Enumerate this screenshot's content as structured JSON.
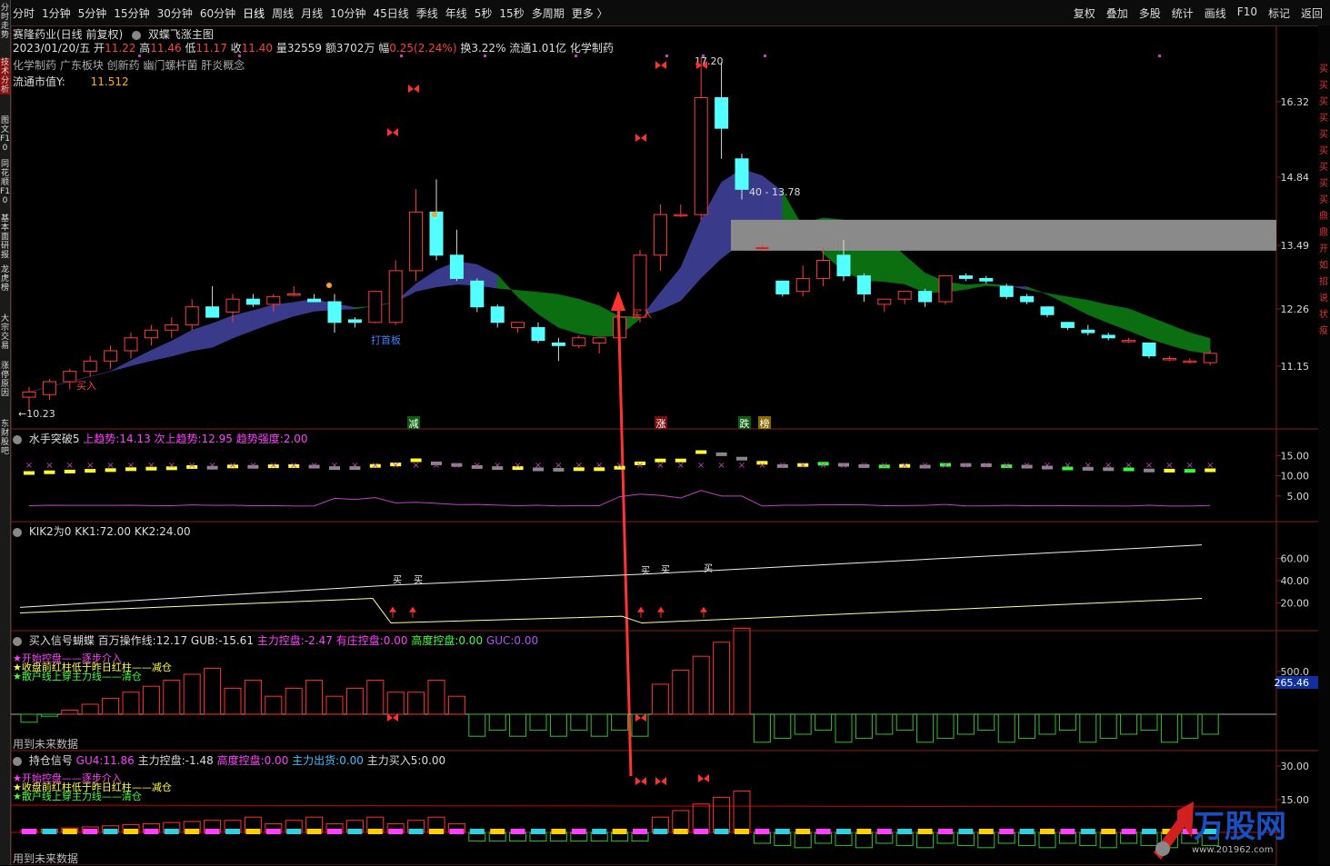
{
  "sidebar": {
    "items": [
      "分时走势",
      "技术分析",
      "图文F10",
      "同花顺F10",
      "基本面研报",
      "龙虎榜",
      "大宗交易",
      "涨停原因",
      "东财股吧"
    ]
  },
  "toolbar": {
    "periods": [
      "分时",
      "1分钟",
      "5分钟",
      "15分钟",
      "30分钟",
      "60分钟",
      "日线",
      "周线",
      "月线",
      "10分钟",
      "45日线",
      "季线",
      "年线",
      "5秒",
      "15秒",
      "多周期",
      "更多 〉"
    ],
    "tools": [
      "复权",
      "叠加",
      "多股",
      "统计",
      "画线",
      "F10",
      "标记",
      "返回"
    ]
  },
  "stock": {
    "title": "赛隆药业(日线 前复权)",
    "main_indicator": "双蝶飞涨主图",
    "date": "2023/01/20/五",
    "open_label": "开",
    "open": "11.22",
    "high_label": "高",
    "high": "11.46",
    "low_label": "低",
    "low": "11.17",
    "close_label": "收",
    "close": "11.40",
    "vol_label": "量",
    "vol": "32559",
    "amount_label": "额",
    "amount": "3702万",
    "change_label": "幅",
    "change": "0.25(2.24%)",
    "turnover_label": "换",
    "turnover": "3.22%",
    "float_label": "流通",
    "float": "1.01亿",
    "sector_main": "化学制药",
    "sectors": "化学制药 广东板块 创新药 幽门螺杆菌 肝炎概念",
    "mv_label": "流通市值Y:",
    "mv_value": "11.512"
  },
  "price_axis": [
    "16.32",
    "14.84",
    "13.49",
    "12.26",
    "11.15"
  ],
  "chart_labels": {
    "high_mark": "17.20",
    "low_mark": "10.23",
    "range_mark": "40 - 13.78",
    "buy_entry": "买入",
    "buy_entry2": "买入",
    "limit_label": "打首板",
    "marker_reduce": "减",
    "marker_rise": "涨",
    "marker_fall": "跌",
    "marker_bang": "榜"
  },
  "panel1": {
    "name": "水手突破5",
    "v1_label": "上趋势:",
    "v1": "14.13",
    "v2_label": "次上趋势:",
    "v2": "12.95",
    "v3_label": "趋势强度:",
    "v3": "2.00",
    "axis": [
      "15.00",
      "10.00",
      "5.00"
    ]
  },
  "panel2": {
    "name": "KIK2为0",
    "v1_label": "KK1:",
    "v1": "72.00",
    "v2_label": "KK2:",
    "v2": "24.00",
    "axis": [
      "60.00",
      "40.00",
      "20.00"
    ],
    "mark_buy": "买"
  },
  "panel3": {
    "name": "买入信号蝴蝶",
    "v1_label": "百万操作线:",
    "v1": "12.17",
    "v2_label": "GUB:",
    "v2": "-15.61",
    "v3_label": "主力控盘:",
    "v3": "-2.47",
    "v4_label": "有庄控盘:",
    "v4": "0.00",
    "v5_label": "高度控盘:",
    "v5": "0.00",
    "v6_label": "GUC:",
    "v6": "0.00",
    "legend1": "★开始控盘——逐步介入",
    "legend2": "★收盘前红柱低于昨日红柱——减仓",
    "legend3": "★散户线上穿主力线——清仓",
    "future_note": "用到未来数据",
    "axis": [
      "500.0"
    ],
    "axis_highlight": "265.46"
  },
  "panel4": {
    "name": "持仓信号",
    "v1_label": "GU4:",
    "v1": "11.86",
    "v2_label": "主力控盘:",
    "v2": "-1.48",
    "v3_label": "高度控盘:",
    "v3": "0.00",
    "v4_label": "主力出货:",
    "v4": "0.00",
    "v5_label": "主力买入5:",
    "v5": "0.00",
    "legend1": "★开始控盘——逐步介入",
    "legend2": "★收盘前红柱低于昨日红柱——减仓",
    "legend3": "★散户线上穿主力线——清仓",
    "future_note": "用到未来数据",
    "axis": [
      "30.00",
      "15.00"
    ]
  },
  "watermark": {
    "brand": "万股网",
    "url": "www.201962.com"
  },
  "right_strip": "买买买买买买买买买鼎鼎开如招说状疫",
  "colors": {
    "up": "#ff3b3b",
    "down": "#54ffff",
    "bg": "#000000",
    "axis": "#8b1a1a",
    "ribbon_up": "#3a3a8a",
    "ribbon_down": "#0b6e10",
    "gray_box": "#8a8a8a",
    "arrow": "#ff3333"
  },
  "candles": [
    {
      "o": 10.55,
      "h": 10.75,
      "l": 10.3,
      "c": 10.65
    },
    {
      "o": 10.6,
      "h": 10.9,
      "l": 10.5,
      "c": 10.85
    },
    {
      "o": 10.85,
      "h": 11.1,
      "l": 10.7,
      "c": 11.05
    },
    {
      "o": 11.05,
      "h": 11.35,
      "l": 10.95,
      "c": 11.25
    },
    {
      "o": 11.25,
      "h": 11.55,
      "l": 11.1,
      "c": 11.45
    },
    {
      "o": 11.45,
      "h": 11.8,
      "l": 11.3,
      "c": 11.7
    },
    {
      "o": 11.7,
      "h": 11.95,
      "l": 11.55,
      "c": 11.85
    },
    {
      "o": 11.85,
      "h": 12.1,
      "l": 11.7,
      "c": 11.95
    },
    {
      "o": 11.95,
      "h": 12.45,
      "l": 11.85,
      "c": 12.3
    },
    {
      "o": 12.3,
      "h": 12.7,
      "l": 12.1,
      "c": 12.1
    },
    {
      "o": 12.2,
      "h": 12.55,
      "l": 12.0,
      "c": 12.45
    },
    {
      "o": 12.45,
      "h": 12.55,
      "l": 12.3,
      "c": 12.35
    },
    {
      "o": 12.35,
      "h": 12.55,
      "l": 12.2,
      "c": 12.5
    },
    {
      "o": 12.55,
      "h": 12.7,
      "l": 12.5,
      "c": 12.55
    },
    {
      "o": 12.45,
      "h": 12.55,
      "l": 12.4,
      "c": 12.4
    },
    {
      "o": 12.4,
      "h": 12.55,
      "l": 11.8,
      "c": 12.0
    },
    {
      "o": 12.05,
      "h": 12.1,
      "l": 11.9,
      "c": 12.0
    },
    {
      "o": 12.0,
      "h": 12.6,
      "l": 11.98,
      "c": 12.6
    },
    {
      "o": 12.0,
      "h": 13.2,
      "l": 11.95,
      "c": 13.0
    },
    {
      "o": 13.0,
      "h": 14.6,
      "l": 12.8,
      "c": 14.15
    },
    {
      "o": 14.15,
      "h": 14.8,
      "l": 13.2,
      "c": 13.3
    },
    {
      "o": 13.3,
      "h": 13.8,
      "l": 12.8,
      "c": 12.85
    },
    {
      "o": 12.8,
      "h": 12.85,
      "l": 12.2,
      "c": 12.3
    },
    {
      "o": 12.3,
      "h": 12.35,
      "l": 11.9,
      "c": 12.0
    },
    {
      "o": 11.9,
      "h": 12.0,
      "l": 11.8,
      "c": 12.0
    },
    {
      "o": 11.9,
      "h": 12.0,
      "l": 11.6,
      "c": 11.65
    },
    {
      "o": 11.6,
      "h": 11.7,
      "l": 11.25,
      "c": 11.55
    },
    {
      "o": 11.55,
      "h": 11.75,
      "l": 11.5,
      "c": 11.7
    },
    {
      "o": 11.6,
      "h": 11.7,
      "l": 11.4,
      "c": 11.7
    },
    {
      "o": 11.7,
      "h": 12.3,
      "l": 11.6,
      "c": 12.1
    },
    {
      "o": 12.1,
      "h": 13.4,
      "l": 12.0,
      "c": 13.3
    },
    {
      "o": 13.3,
      "h": 14.3,
      "l": 13.0,
      "c": 14.1
    },
    {
      "o": 14.1,
      "h": 14.3,
      "l": 14.05,
      "c": 14.1
    },
    {
      "o": 14.1,
      "h": 17.2,
      "l": 14.0,
      "c": 16.4
    },
    {
      "o": 16.4,
      "h": 17.1,
      "l": 15.2,
      "c": 15.8
    },
    {
      "o": 15.2,
      "h": 15.3,
      "l": 14.4,
      "c": 14.6
    },
    {
      "o": 13.45,
      "h": 13.5,
      "l": 13.4,
      "c": 13.45
    },
    {
      "o": 12.8,
      "h": 12.8,
      "l": 12.5,
      "c": 12.55
    },
    {
      "o": 12.6,
      "h": 13.1,
      "l": 12.5,
      "c": 12.85
    },
    {
      "o": 12.85,
      "h": 13.45,
      "l": 12.7,
      "c": 13.2
    },
    {
      "o": 13.3,
      "h": 13.6,
      "l": 12.8,
      "c": 12.9
    },
    {
      "o": 12.9,
      "h": 12.95,
      "l": 12.4,
      "c": 12.55
    },
    {
      "o": 12.35,
      "h": 12.45,
      "l": 12.2,
      "c": 12.45
    },
    {
      "o": 12.45,
      "h": 12.6,
      "l": 12.35,
      "c": 12.6
    },
    {
      "o": 12.6,
      "h": 12.65,
      "l": 12.3,
      "c": 12.4
    },
    {
      "o": 12.4,
      "h": 12.9,
      "l": 12.35,
      "c": 12.9
    },
    {
      "o": 12.9,
      "h": 12.95,
      "l": 12.8,
      "c": 12.85
    },
    {
      "o": 12.85,
      "h": 12.9,
      "l": 12.75,
      "c": 12.8
    },
    {
      "o": 12.7,
      "h": 12.75,
      "l": 12.45,
      "c": 12.5
    },
    {
      "o": 12.5,
      "h": 12.55,
      "l": 12.35,
      "c": 12.4
    },
    {
      "o": 12.3,
      "h": 12.3,
      "l": 12.1,
      "c": 12.15
    },
    {
      "o": 12.0,
      "h": 12.0,
      "l": 11.85,
      "c": 11.9
    },
    {
      "o": 11.85,
      "h": 11.95,
      "l": 11.75,
      "c": 11.8
    },
    {
      "o": 11.75,
      "h": 11.8,
      "l": 11.65,
      "c": 11.7
    },
    {
      "o": 11.65,
      "h": 11.7,
      "l": 11.6,
      "c": 11.65
    },
    {
      "o": 11.6,
      "h": 11.6,
      "l": 11.3,
      "c": 11.35
    },
    {
      "o": 11.3,
      "h": 11.35,
      "l": 11.25,
      "c": 11.3
    },
    {
      "o": 11.25,
      "h": 11.3,
      "l": 11.2,
      "c": 11.25
    },
    {
      "o": 11.22,
      "h": 11.46,
      "l": 11.17,
      "c": 11.4
    }
  ]
}
